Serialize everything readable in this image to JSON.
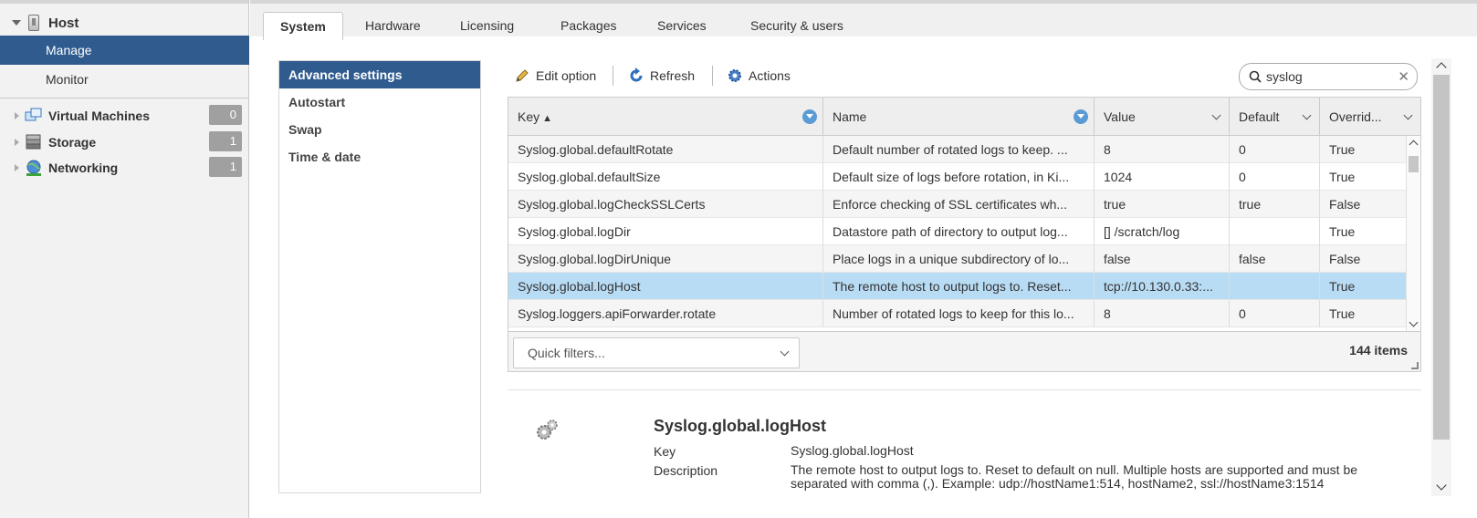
{
  "nav": {
    "host": "Host",
    "subitems": [
      "Manage",
      "Monitor"
    ],
    "items": [
      {
        "label": "Virtual Machines",
        "count": "0",
        "icon": "virtual-machines-icon"
      },
      {
        "label": "Storage",
        "count": "1",
        "icon": "storage-icon"
      },
      {
        "label": "Networking",
        "count": "1",
        "icon": "networking-icon"
      }
    ]
  },
  "tabs": [
    "System",
    "Hardware",
    "Licensing",
    "Packages",
    "Services",
    "Security & users"
  ],
  "submenu": [
    "Advanced settings",
    "Autostart",
    "Swap",
    "Time & date"
  ],
  "toolbar": {
    "edit": "Edit option",
    "refresh": "Refresh",
    "actions": "Actions"
  },
  "search": {
    "value": "syslog"
  },
  "grid": {
    "headers": [
      "Key",
      "Name",
      "Value",
      "Default",
      "Overrid..."
    ],
    "sort_indicator": "▲",
    "rows": [
      {
        "key": "Syslog.global.defaultRotate",
        "name": "Default number of rotated logs to keep. ...",
        "value": "8",
        "default": "0",
        "override": "True"
      },
      {
        "key": "Syslog.global.defaultSize",
        "name": "Default size of logs before rotation, in Ki...",
        "value": "1024",
        "default": "0",
        "override": "True"
      },
      {
        "key": "Syslog.global.logCheckSSLCerts",
        "name": "Enforce checking of SSL certificates wh...",
        "value": "true",
        "default": "true",
        "override": "False"
      },
      {
        "key": "Syslog.global.logDir",
        "name": "Datastore path of directory to output log...",
        "value": "[] /scratch/log",
        "default": "",
        "override": "True"
      },
      {
        "key": "Syslog.global.logDirUnique",
        "name": "Place logs in a unique subdirectory of lo...",
        "value": "false",
        "default": "false",
        "override": "False"
      },
      {
        "key": "Syslog.global.logHost",
        "name": "The remote host to output logs to. Reset...",
        "value": "tcp://10.130.0.33:...",
        "default": "",
        "override": "True"
      },
      {
        "key": "Syslog.loggers.apiForwarder.rotate",
        "name": "Number of rotated logs to keep for this lo...",
        "value": "8",
        "default": "0",
        "override": "True"
      }
    ],
    "selected_row": 5,
    "quick_filters": "Quick filters...",
    "item_count": "144 items"
  },
  "detail": {
    "title": "Syslog.global.logHost",
    "key_label": "Key",
    "key_value": "Syslog.global.logHost",
    "desc_label": "Description",
    "desc_value": "The remote host to output logs to. Reset to default on null. Multiple hosts are supported and must be separated with comma (,). Example: udp://hostName1:514, hostName2, ssl://hostName3:1514"
  },
  "colors": {
    "nav_active": "#2f5b8f",
    "row_selected": "#b9dcf5",
    "count_badge": "#a0a0a0"
  }
}
